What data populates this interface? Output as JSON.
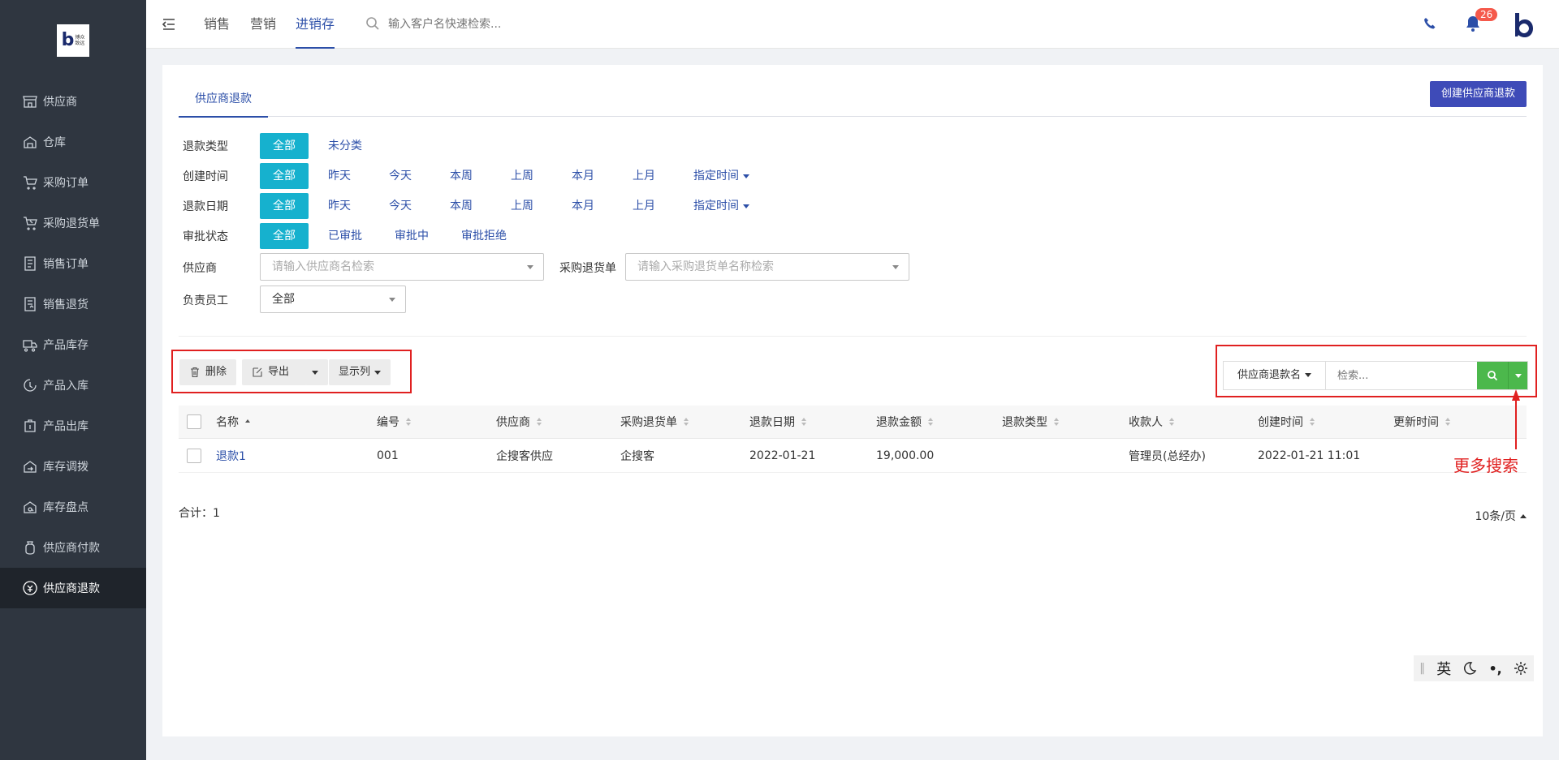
{
  "brand": {
    "logo_text_line1": "博众",
    "logo_text_line2": "致远",
    "logo_letter": "b"
  },
  "sidebar": {
    "items": [
      {
        "label": "供应商",
        "icon": "store-icon"
      },
      {
        "label": "仓库",
        "icon": "warehouse-icon"
      },
      {
        "label": "采购订单",
        "icon": "cart-icon"
      },
      {
        "label": "采购退货单",
        "icon": "cart-return-icon"
      },
      {
        "label": "销售订单",
        "icon": "document-icon"
      },
      {
        "label": "销售退货",
        "icon": "document-return-icon"
      },
      {
        "label": "产品库存",
        "icon": "truck-icon"
      },
      {
        "label": "产品入库",
        "icon": "inbound-icon"
      },
      {
        "label": "产品出库",
        "icon": "outbound-icon"
      },
      {
        "label": "库存调拨",
        "icon": "transfer-icon"
      },
      {
        "label": "库存盘点",
        "icon": "inventory-check-icon"
      },
      {
        "label": "供应商付款",
        "icon": "money-bag-icon"
      },
      {
        "label": "供应商退款",
        "icon": "refund-icon"
      }
    ],
    "active_index": 12
  },
  "header": {
    "tabs": [
      "销售",
      "营销",
      "进销存"
    ],
    "active_tab": 2,
    "search_placeholder": "输入客户名快速检索...",
    "notification_count": "26"
  },
  "page": {
    "tab_label": "供应商退款",
    "create_button": "创建供应商退款",
    "filters": {
      "refund_type": {
        "label": "退款类型",
        "options": [
          "全部",
          "未分类"
        ]
      },
      "created_time": {
        "label": "创建时间",
        "options": [
          "全部",
          "昨天",
          "今天",
          "本周",
          "上周",
          "本月",
          "上月"
        ],
        "custom": "指定时间"
      },
      "refund_date": {
        "label": "退款日期",
        "options": [
          "全部",
          "昨天",
          "今天",
          "本周",
          "上周",
          "本月",
          "上月"
        ],
        "custom": "指定时间"
      },
      "approval": {
        "label": "审批状态",
        "options": [
          "全部",
          "已审批",
          "审批中",
          "审批拒绝"
        ]
      },
      "supplier": {
        "label": "供应商",
        "placeholder": "请输入供应商名检索"
      },
      "purchase_return": {
        "label": "采购退货单",
        "placeholder": "请输入采购退货单名称检索"
      },
      "staff": {
        "label": "负责员工",
        "value": "全部"
      }
    },
    "toolbar": {
      "delete": "删除",
      "export": "导出",
      "columns": "显示列"
    },
    "search": {
      "field": "供应商退款名",
      "placeholder": "检索..."
    },
    "table": {
      "columns": [
        "名称",
        "编号",
        "供应商",
        "采购退货单",
        "退款日期",
        "退款金额",
        "退款类型",
        "收款人",
        "创建时间",
        "更新时间"
      ],
      "rows": [
        {
          "name": "退款1",
          "code": "001",
          "supplier": "企搜客供应",
          "purchase_return": "企搜客",
          "refund_date": "2022-01-21",
          "amount": "19,000.00",
          "type": "",
          "payee": "管理员(总经办)",
          "created": "2022-01-21 11:01",
          "updated": ""
        }
      ]
    },
    "total_label": "合计：",
    "total_value": "1",
    "page_size": "10条/页"
  },
  "annotation": {
    "text": "更多搜索",
    "color": "#e02020"
  },
  "ime": {
    "lang": "英"
  },
  "colors": {
    "sidebar_bg": "#2f3640",
    "accent_blue": "#2c4fa8",
    "chip_active": "#16b1ce",
    "create_btn": "#3e4bb8",
    "search_green": "#4cb84c"
  }
}
